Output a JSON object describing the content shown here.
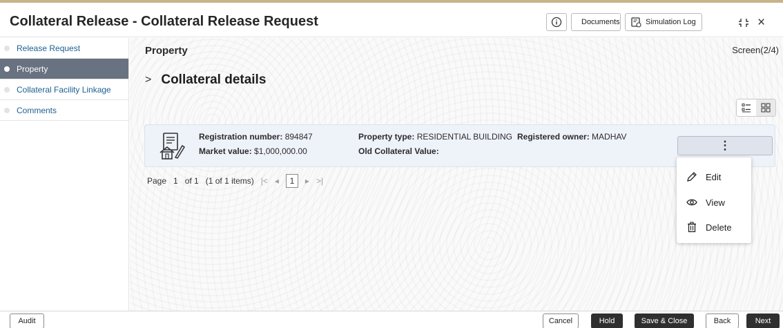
{
  "header": {
    "title": "Collateral Release - Collateral Release Request",
    "documents_label": "Documents",
    "simulation_label": "Simulation Log",
    "info_icon": "info-circle-icon",
    "documents_icon": "document-icon",
    "simulation_icon": "log-icon",
    "collapse_icon": "collapse-icon",
    "close_icon": "close-icon",
    "close_glyph": "×"
  },
  "sidebar": {
    "items": [
      {
        "label": "Release Request",
        "active": false
      },
      {
        "label": "Property",
        "active": true
      },
      {
        "label": "Collateral Facility Linkage",
        "active": false
      },
      {
        "label": "Comments",
        "active": false
      }
    ]
  },
  "main": {
    "section_title": "Property",
    "screen_count": "Screen(2/4)",
    "collateral_heading": "Collateral details",
    "chevron_glyph": ">",
    "view_toggle": {
      "list_icon": "list-view-icon",
      "grid_icon": "grid-view-icon",
      "selected": "grid"
    },
    "card": {
      "icon": "property-document-icon",
      "registration_number_label": "Registration number:",
      "registration_number_value": "894847",
      "market_value_label": "Market value:",
      "market_value_value": "$1,000,000.00",
      "property_type_label": "Property type:",
      "property_type_value": "RESIDENTIAL BUILDING",
      "old_collateral_label": "Old Collateral Value:",
      "old_collateral_value": "",
      "registered_owner_label": "Registered owner:",
      "registered_owner_value": "MADHAV",
      "kebab_glyph": "⋮"
    },
    "pager": {
      "page_label": "Page",
      "current_page": "1",
      "of_label": "of 1",
      "items_label": "(1 of 1 items)",
      "first_glyph": "|<",
      "prev_glyph": "◂",
      "next_glyph": "▸",
      "last_glyph": ">|"
    },
    "context_menu": {
      "items": [
        {
          "label": "Edit",
          "icon": "pencil-icon"
        },
        {
          "label": "View",
          "icon": "eye-icon"
        },
        {
          "label": "Delete",
          "icon": "trash-icon"
        }
      ]
    }
  },
  "footer": {
    "audit_label": "Audit",
    "cancel_label": "Cancel",
    "hold_label": "Hold",
    "save_close_label": "Save & Close",
    "back_label": "Back",
    "next_label": "Next"
  }
}
